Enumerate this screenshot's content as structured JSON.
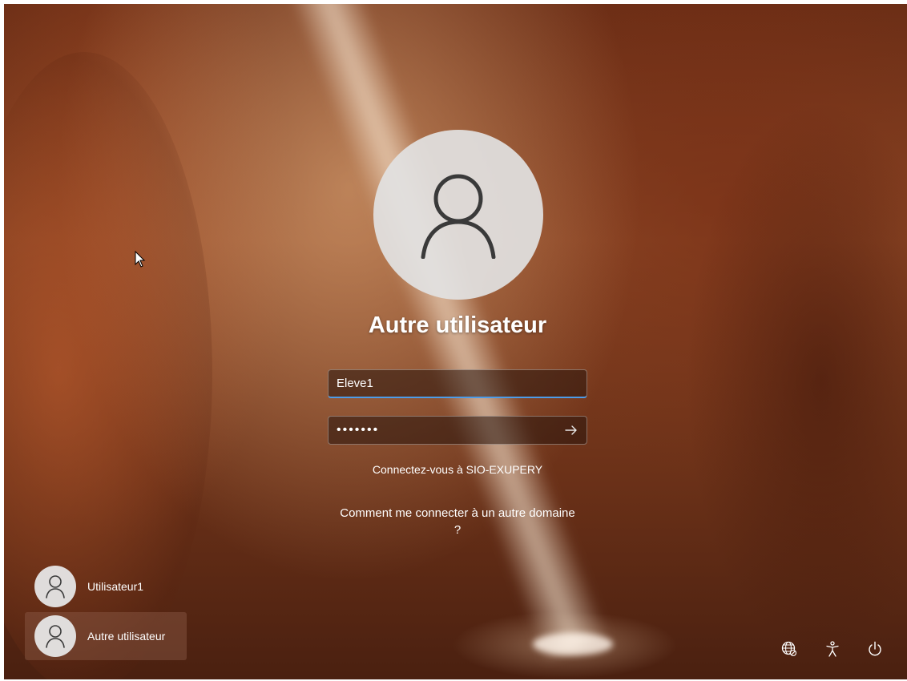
{
  "login": {
    "user_display_name": "Autre utilisateur",
    "username_value": "Eleve1",
    "password_mask": "•••••••",
    "sign_in_domain_text": "Connectez-vous à SIO-EXUPERY",
    "other_domain_link": "Comment me connecter à un autre domaine ?"
  },
  "user_list": [
    {
      "label": "Utilisateur1",
      "selected": false
    },
    {
      "label": "Autre utilisateur",
      "selected": true
    }
  ],
  "corner_controls": {
    "icons": [
      "network-icon",
      "accessibility-icon",
      "power-icon"
    ]
  },
  "colors": {
    "focus_underline": "#4d9ce8",
    "avatar_bg": "#e2e2e2",
    "avatar_glyph": "#3a3a3a"
  }
}
